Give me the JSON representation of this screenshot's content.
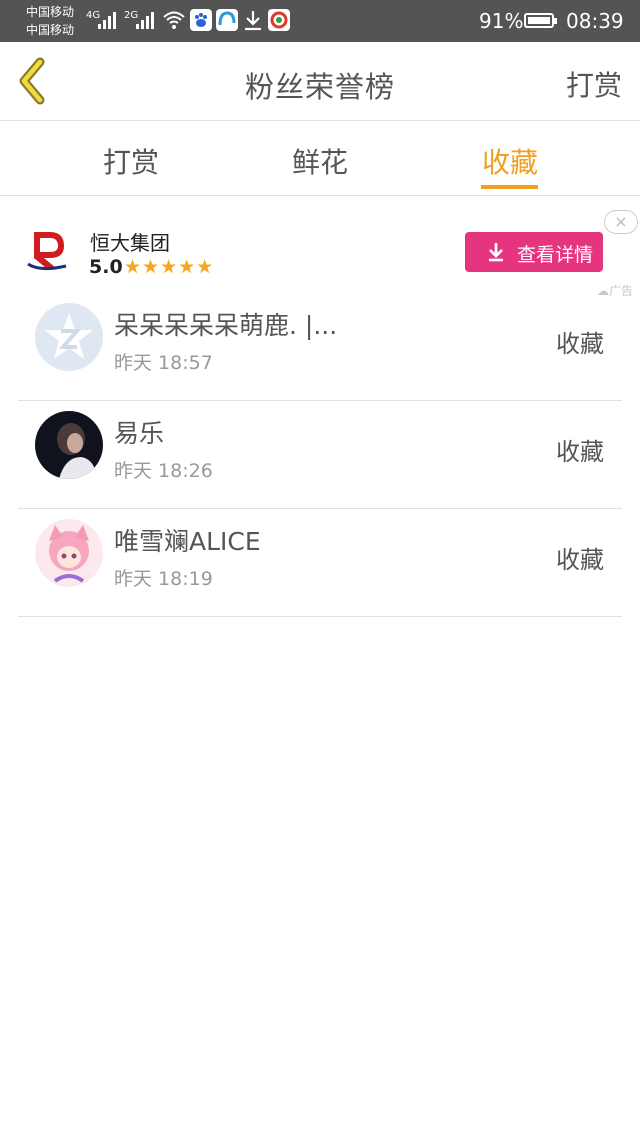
{
  "status_bar": {
    "carrier_1": "中国移动",
    "carrier_2": "中国移动",
    "network_1": "4G",
    "network_2": "2G",
    "battery": "91%",
    "time": "08:39"
  },
  "header": {
    "title": "粉丝荣誉榜",
    "action": "打赏"
  },
  "tabs": [
    {
      "label": "打赏",
      "active": false
    },
    {
      "label": "鲜花",
      "active": false
    },
    {
      "label": "收藏",
      "active": true
    }
  ],
  "ad": {
    "name": "恒大集团",
    "score": "5.0",
    "stars": "★★★★★",
    "button_label": "查看详情",
    "close": "×",
    "tag": "广告"
  },
  "list": [
    {
      "name": "呆呆呆呆呆萌鹿. |...",
      "time": "昨天 18:57",
      "action": "收藏",
      "avatar": "qq-default-avatar"
    },
    {
      "name": "易乐",
      "time": "昨天 18:26",
      "action": "收藏",
      "avatar": "dark-portrait-avatar"
    },
    {
      "name": "唯雪斓ALICE",
      "time": "昨天 18:19",
      "action": "收藏",
      "avatar": "pink-anime-avatar"
    }
  ],
  "colors": {
    "accent": "#f0a020",
    "ad_button": "#e6357f",
    "status_bar": "#545454"
  }
}
